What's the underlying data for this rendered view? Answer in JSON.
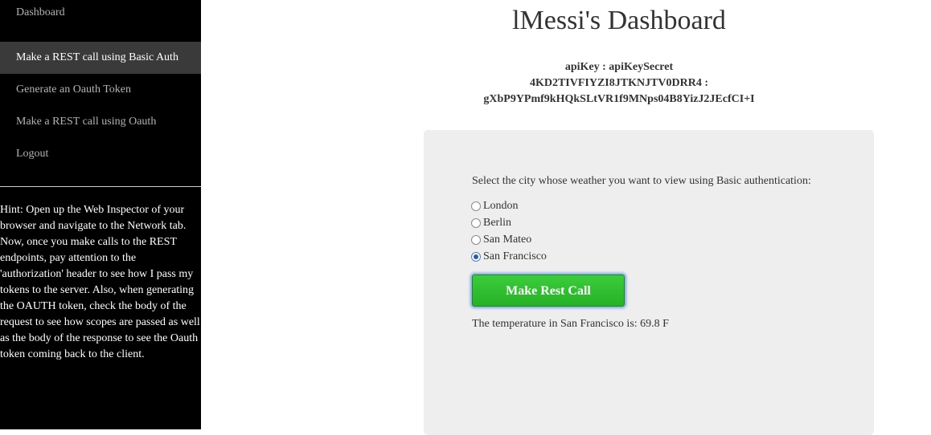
{
  "sidebar": {
    "items": [
      {
        "label": "Dashboard"
      },
      {
        "label": "Make a REST call using Basic Auth"
      },
      {
        "label": "Generate an Oauth Token"
      },
      {
        "label": "Make a REST call using Oauth"
      },
      {
        "label": "Logout"
      }
    ],
    "hint": "Hint: Open up the Web Inspector of your browser and navigate to the Network tab. Now, once you make calls to the REST endpoints, pay attention to the 'authorization' header to see how I pass my tokens to the server. Also, when generating the OAUTH token, check the body of the request to see how scopes are passed as well as the body of the response to see the Oauth token coming back to the client."
  },
  "main": {
    "title": "lMessi's Dashboard",
    "keys_label": "apiKey : apiKeySecret",
    "api_key": "4KD2TIVFIYZI8JTKNJTV0DRR4 :",
    "api_secret": "gXbP9YPmf9kHQkSLtVR1f9MNps04B8YizJ2JEcfCI+I"
  },
  "form": {
    "prompt": "Select the city whose weather you want to view using Basic authentication:",
    "options": [
      {
        "label": "London",
        "checked": false
      },
      {
        "label": "Berlin",
        "checked": false
      },
      {
        "label": "San Mateo",
        "checked": false
      },
      {
        "label": "San Francisco",
        "checked": true
      }
    ],
    "button_label": "Make Rest Call",
    "result": "The temperature in San Francisco is: 69.8 F"
  },
  "colors": {
    "sidebar_bg": "#000000",
    "active_item_bg": "#3a3a3a",
    "panel_bg": "#eeeeee",
    "button_green": "#2fbd2f"
  }
}
